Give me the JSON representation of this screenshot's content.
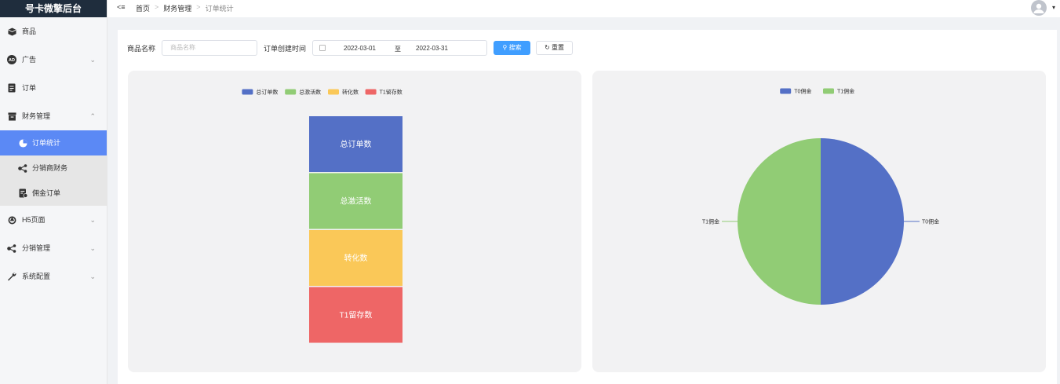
{
  "app": {
    "brand": "号卡微擎后台"
  },
  "sidebar": {
    "items": [
      {
        "label": "商品",
        "icon": "cube-icon",
        "has_chevron": false
      },
      {
        "label": "广告",
        "icon": "ad-icon",
        "has_chevron": true
      },
      {
        "label": "订单",
        "icon": "document-icon",
        "has_chevron": false
      },
      {
        "label": "财务管理",
        "icon": "archive-icon",
        "has_chevron": true,
        "expanded": true
      }
    ],
    "submenu": [
      {
        "label": "订单统计",
        "icon": "pie-icon",
        "active": true
      },
      {
        "label": "分销商财务",
        "icon": "share-icon",
        "active": false
      },
      {
        "label": "佣金订单",
        "icon": "invoice-icon",
        "active": false
      }
    ],
    "items_after": [
      {
        "label": "H5页面",
        "icon": "html5-icon",
        "has_chevron": true
      },
      {
        "label": "分销管理",
        "icon": "share-icon",
        "has_chevron": true
      },
      {
        "label": "系统配置",
        "icon": "wrench-icon",
        "has_chevron": true
      }
    ]
  },
  "topbar": {
    "collapse_label": "<≡",
    "breadcrumb": [
      "首页",
      "财务管理",
      "订单统计"
    ],
    "separator": ">"
  },
  "search": {
    "product_label": "商品名称",
    "product_placeholder": "商品名称",
    "date_label": "订单创建时间",
    "date_start": "2022-03-01",
    "date_sep": "至",
    "date_end": "2022-03-31",
    "search_btn": "搜索",
    "reset_btn": "重置"
  },
  "colors": {
    "blue": "#5470c6",
    "green": "#91cc75",
    "yellow": "#fac858",
    "red": "#ee6666",
    "accent": "#409eff",
    "active_menu": "#5b89f5"
  },
  "chart_data": [
    {
      "type": "funnel",
      "legend": [
        "总订单数",
        "总激活数",
        "转化数",
        "T1留存数"
      ],
      "labels": [
        "总订单数",
        "总激活数",
        "转化数",
        "T1留存数"
      ],
      "values": [
        1,
        1,
        1,
        1
      ],
      "colors": [
        "#5470c6",
        "#91cc75",
        "#fac858",
        "#ee6666"
      ],
      "legend_position": "top-center"
    },
    {
      "type": "pie",
      "legend": [
        "T0佣金",
        "T1佣金"
      ],
      "labels": [
        "T0佣金",
        "T1佣金"
      ],
      "values": [
        1,
        1
      ],
      "colors": [
        "#5470c6",
        "#91cc75"
      ],
      "legend_position": "top-center"
    }
  ]
}
